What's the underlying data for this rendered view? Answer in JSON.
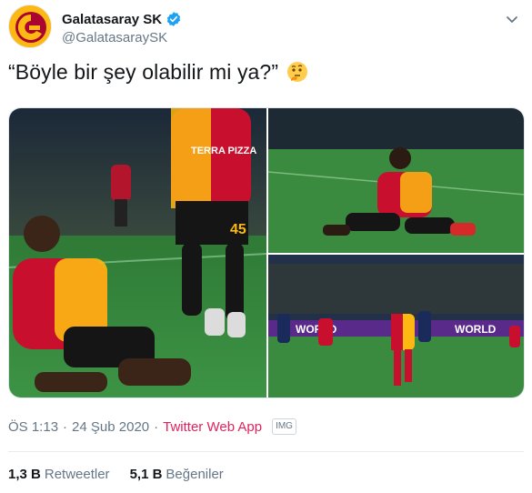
{
  "account": {
    "display_name": "Galatasaray SK",
    "handle": "@GalatasaraySK",
    "verified": true,
    "avatar_icon": "galatasaray-logo"
  },
  "tweet": {
    "text": "“Böyle bir şey olabilir mi ya?”",
    "emoji": "thinking-face-emoji"
  },
  "photos": [
    {
      "description_icon": "photo-player-knee-slide-celebration",
      "shirt_text": "TERRA PIZZA",
      "number": "45"
    },
    {
      "description_icon": "photo-player-knee-slide-celebration-2"
    },
    {
      "description_icon": "photo-player-celebrating-stadium",
      "ad_text": "WORLD"
    }
  ],
  "meta": {
    "time": "ÖS 1:13",
    "separator": "·",
    "date": "24 Şub 2020",
    "source": "Twitter Web App",
    "img_badge": "IMG"
  },
  "stats": {
    "retweets_count": "1,3 B",
    "retweets_label": "Retweetler",
    "likes_count": "5,1 B",
    "likes_label": "Beğeniler"
  },
  "colors": {
    "brand_red": "#a90432",
    "brand_yellow": "#fdb912",
    "link_source": "#e0245e",
    "verified_blue": "#1da1f2"
  }
}
